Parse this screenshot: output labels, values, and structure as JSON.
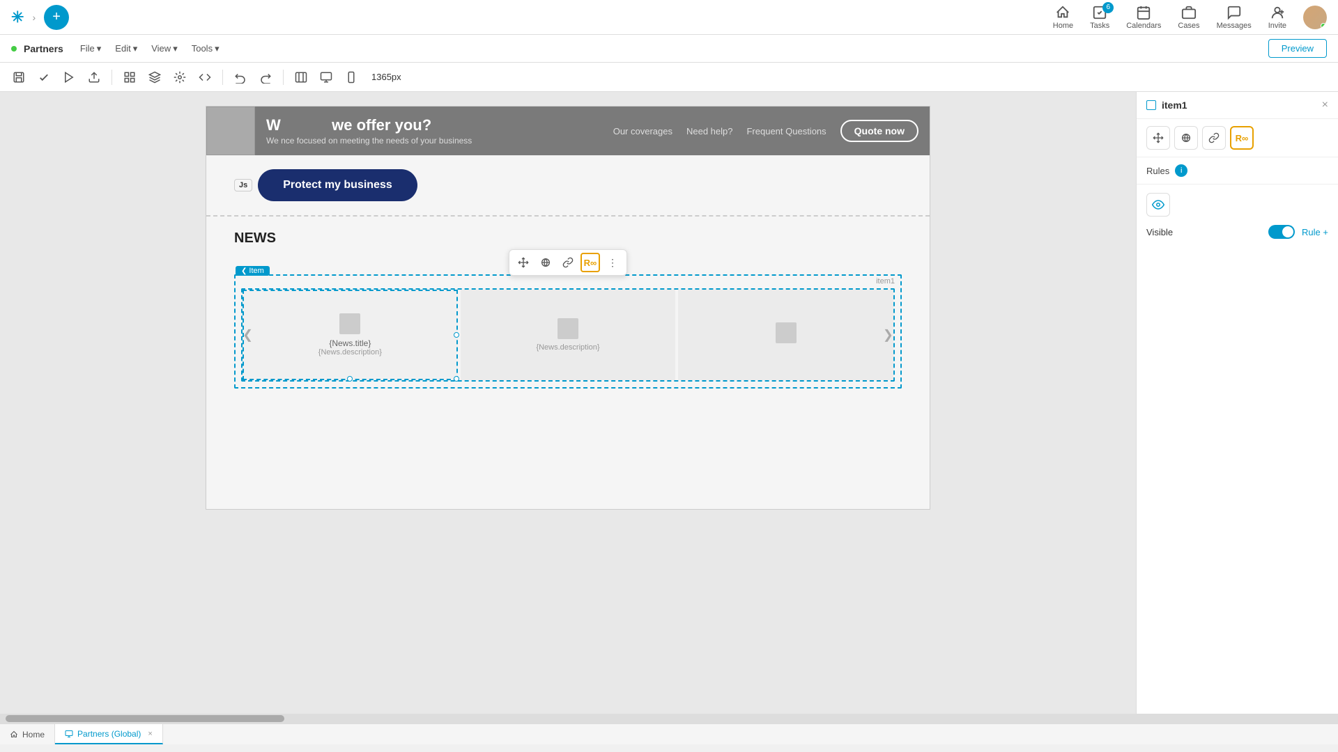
{
  "topnav": {
    "plus_label": "+",
    "home_label": "Home",
    "tasks_label": "Tasks",
    "tasks_badge": "6",
    "calendars_label": "Calendars",
    "cases_label": "Cases",
    "messages_label": "Messages",
    "invite_label": "Invite"
  },
  "secondbar": {
    "partner_name": "Partners",
    "file_label": "File",
    "edit_label": "Edit",
    "view_label": "View",
    "tools_label": "Tools",
    "preview_label": "Preview"
  },
  "toolbar": {
    "px_label": "1365px"
  },
  "hero": {
    "title_partial": "W",
    "title_rest": "we offer you?",
    "subtitle": "We               nce focused on meeting the needs of your business",
    "nav1": "Our coverages",
    "nav2": "Need help?",
    "nav3": "Frequent Questions",
    "quote_btn": "Quote now"
  },
  "protect": {
    "js_badge": "Js",
    "btn_label": "Protect my business"
  },
  "news": {
    "section_title": "NEWS",
    "item_label": "Item",
    "item1_label": "item1",
    "card1_title": "{News.title}",
    "card1_desc": "{News.description}",
    "card2_desc": "{News.description}",
    "card3_desc": ""
  },
  "right_panel": {
    "item_name": "item1",
    "close_label": "×",
    "rules_label": "Rules",
    "visible_label": "Visible",
    "rule_label": "Rule +"
  }
}
